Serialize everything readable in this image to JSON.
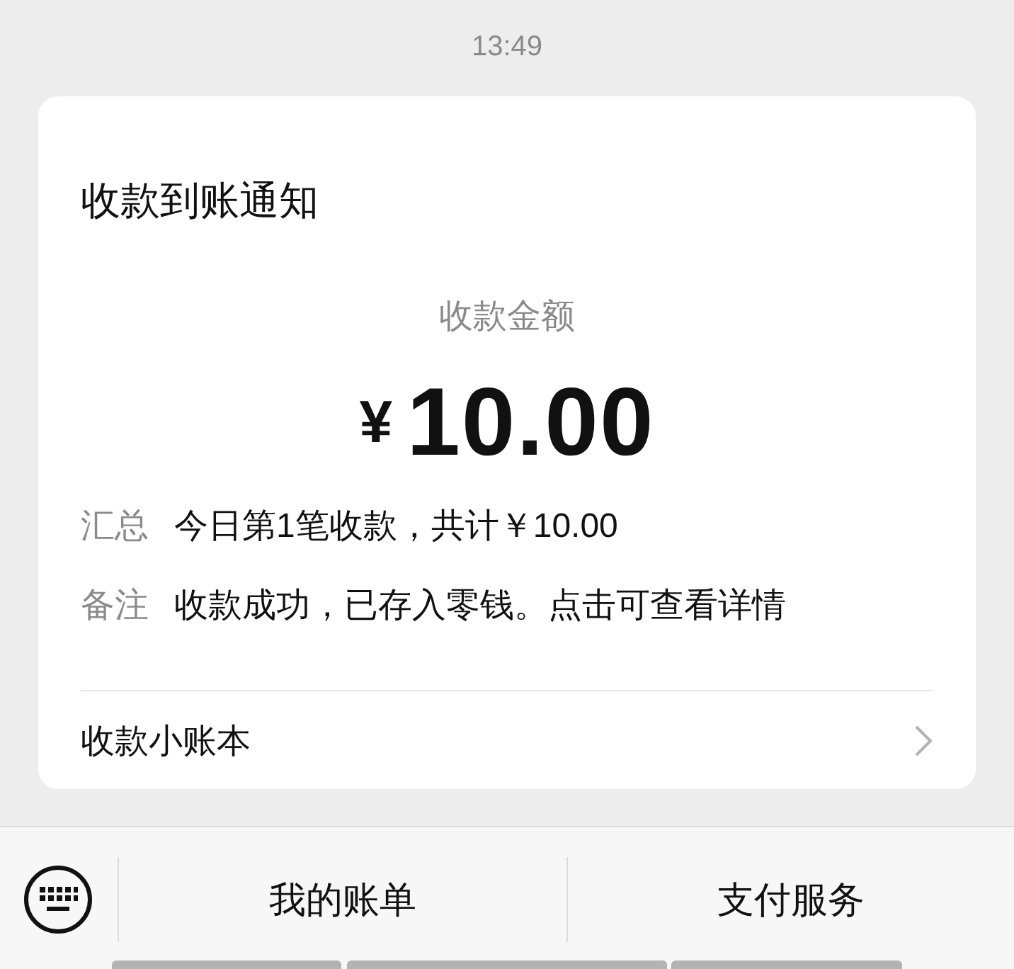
{
  "time": "13:49",
  "card": {
    "title": "收款到账通知",
    "amount_label": "收款金额",
    "currency": "¥",
    "amount": "10.00",
    "rows": [
      {
        "label": "汇总",
        "value": "今日第1笔收款，共计￥10.00"
      },
      {
        "label": "备注",
        "value": "收款成功，已存入零钱。点击可查看详情"
      }
    ],
    "footer": "收款小账本"
  },
  "menu": [
    "我的账单",
    "支付服务"
  ]
}
